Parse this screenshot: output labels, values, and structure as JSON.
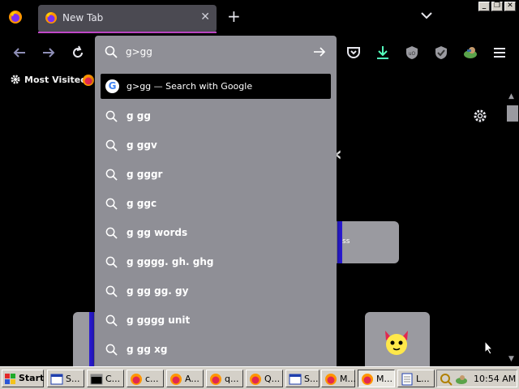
{
  "browser": {
    "tab": {
      "title": "New Tab",
      "close": "✕"
    },
    "new_tab": "+",
    "window_controls": [
      "_",
      "❐",
      "✕"
    ]
  },
  "bookmarks": {
    "most_visited": "Most Visited"
  },
  "urlbar": {
    "query": "g>gg",
    "top_suggestion": {
      "query": "g>gg",
      "separator": " — ",
      "action": "Search with Google",
      "engine_letter": "G"
    },
    "suggestions": [
      "g gg",
      "g ggv",
      "g gggr",
      "g ggc",
      "g gg words",
      "g gggg. gh. ghg",
      "g gg gg. gy",
      "g gggg unit",
      "g gg xg"
    ]
  },
  "content": {
    "tile_partial_text": "ss"
  },
  "taskbar": {
    "start": "Start",
    "buttons": [
      {
        "label": "S...",
        "icon": "window-icon"
      },
      {
        "label": "C...",
        "icon": "console-icon"
      },
      {
        "label": "c...",
        "icon": "firefox-icon"
      },
      {
        "label": "A...",
        "icon": "firefox-icon"
      },
      {
        "label": "q...",
        "icon": "firefox-icon"
      },
      {
        "label": "Q...",
        "icon": "firefox-icon"
      },
      {
        "label": "S...",
        "icon": "window-icon"
      },
      {
        "label": "M...",
        "icon": "firefox-icon"
      },
      {
        "label": "M...",
        "icon": "firefox-icon",
        "active": true
      },
      {
        "label": "L...",
        "icon": "notepad-icon"
      }
    ],
    "clock": "10:54 AM"
  },
  "colors": {
    "accent_purple": "#c047c8",
    "urlbar_bg": "#8f8f96",
    "tile_blue": "#2a1bd6",
    "taskbar": "#d4d0c8"
  }
}
